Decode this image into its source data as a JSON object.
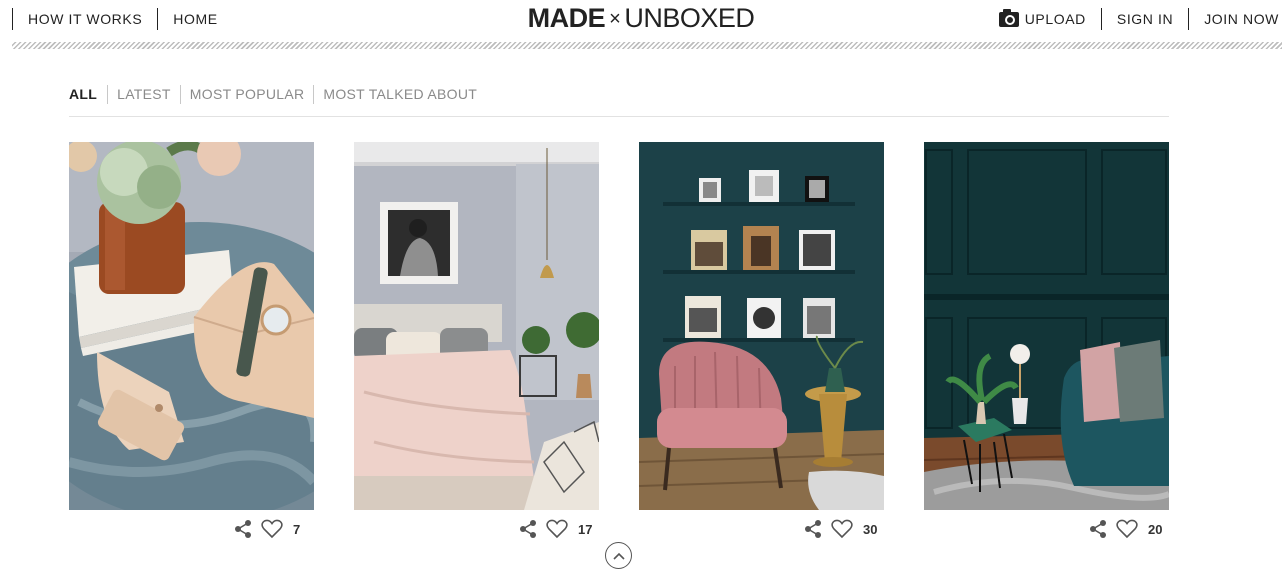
{
  "header": {
    "nav_left": [
      "HOW IT WORKS",
      "HOME"
    ],
    "logo": {
      "made": "MADE",
      "x": "×",
      "unboxed": "UNBOXED"
    },
    "upload_label": "UPLOAD",
    "sign_in_label": "SIGN IN",
    "join_now_label": "JOIN NOW"
  },
  "filters": {
    "tabs": [
      "ALL",
      "LATEST",
      "MOST POPULAR",
      "MOST TALKED ABOUT"
    ],
    "active": "ALL"
  },
  "posts": [
    {
      "scene": "table-with-peony-vase-and-leather-pouch",
      "likes": "7"
    },
    {
      "scene": "bedroom-with-blush-bedding-and-brass-pendant",
      "likes": "17"
    },
    {
      "scene": "teal-room-with-pink-velvet-chair-and-shelves",
      "likes": "30"
    },
    {
      "scene": "dark-teal-paneled-room-with-velvet-sofa",
      "likes": "20"
    }
  ],
  "icons": {
    "upload": "camera-icon",
    "share": "share-icon",
    "like": "heart-icon",
    "scroll_top": "chevron-up-icon"
  },
  "colors": {
    "text": "#222222",
    "muted": "#8a8a8a",
    "divider": "#e2e2e2"
  }
}
